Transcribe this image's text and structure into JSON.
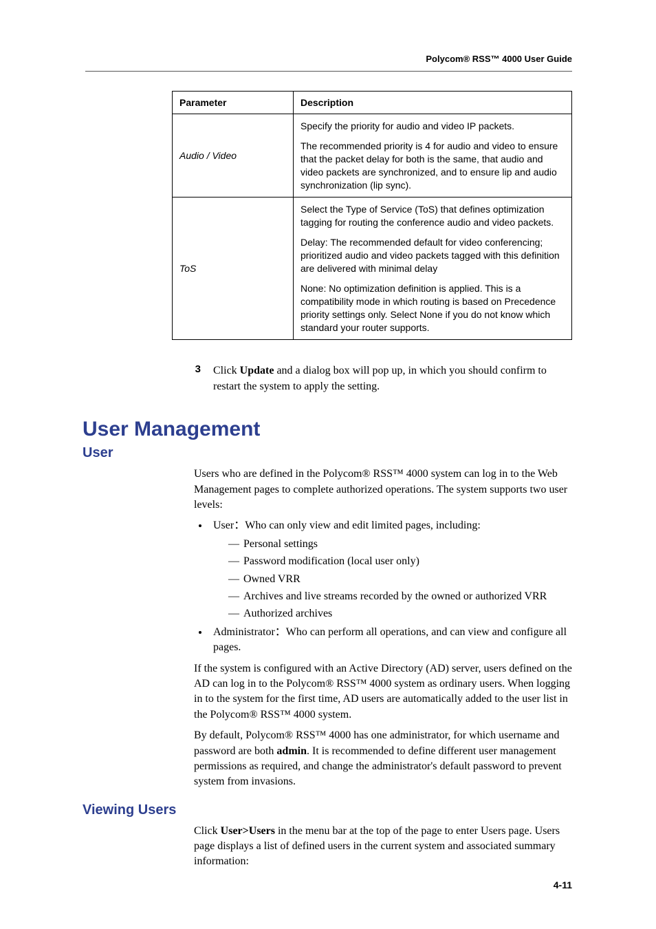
{
  "header": {
    "title": "Polycom® RSS™ 4000 User Guide"
  },
  "table": {
    "headers": {
      "param": "Parameter",
      "desc": "Description"
    },
    "rows": [
      {
        "param": "Audio / Video",
        "desc_p1": "Specify the priority for audio and video IP packets.",
        "desc_p2": "The recommended priority is 4 for audio and video to ensure that the packet delay for both is the same, that audio and video packets are synchronized, and to ensure lip and audio synchronization (lip sync)."
      },
      {
        "param": "ToS",
        "desc_p1": "Select the Type of Service (ToS) that defines optimization tagging for routing the conference audio and video packets.",
        "desc_p2": "Delay: The recommended default for video conferencing; prioritized audio and video packets tagged with this definition are delivered with minimal delay",
        "desc_p3": "None: No optimization definition is applied. This is a compatibility mode in which routing is based on Precedence priority settings only. Select None if you do not know which standard your router supports."
      }
    ]
  },
  "step3": {
    "num": "3",
    "text_pre": "Click ",
    "text_bold": "Update",
    "text_post": " and a dialog box will pop up, in which you should confirm to restart the system to apply the setting."
  },
  "sections": {
    "h1": "User Management",
    "h2a": "User",
    "h2b": "Viewing Users"
  },
  "user": {
    "intro": "Users who are defined in the Polycom® RSS™ 4000 system can log in to the Web Management pages to complete authorized operations. The system supports two user levels:",
    "b1_pre": "User：Who can only view and edit limited pages, including:",
    "b1_sub": [
      "Personal settings",
      "Password modification (local user only)",
      "Owned VRR",
      "Archives and live streams recorded by the owned or authorized VRR",
      "Authorized archives"
    ],
    "b2": "Administrator：Who can perform all operations, and can view and configure all pages.",
    "para_ad": "If the system is configured with an Active Directory (AD) server, users defined on the AD can log in to the Polycom® RSS™ 4000 system as ordinary users. When logging in to the system for the first time, AD users are automatically added to the user list in the Polycom® RSS™ 4000 system.",
    "para_default_pre": "By default, Polycom® RSS™ 4000 has one administrator, for which username and password are both ",
    "para_default_bold": "admin",
    "para_default_post": ". It is recommended to define different user management permissions as required, and change the administrator's default password to prevent system from invasions."
  },
  "viewing": {
    "para_pre": "Click ",
    "para_bold": "User>Users",
    "para_post": " in the menu bar at the top of the page to enter Users page. Users page displays a list of defined users in the current system and associated summary information:"
  },
  "pagenum": "4-11"
}
